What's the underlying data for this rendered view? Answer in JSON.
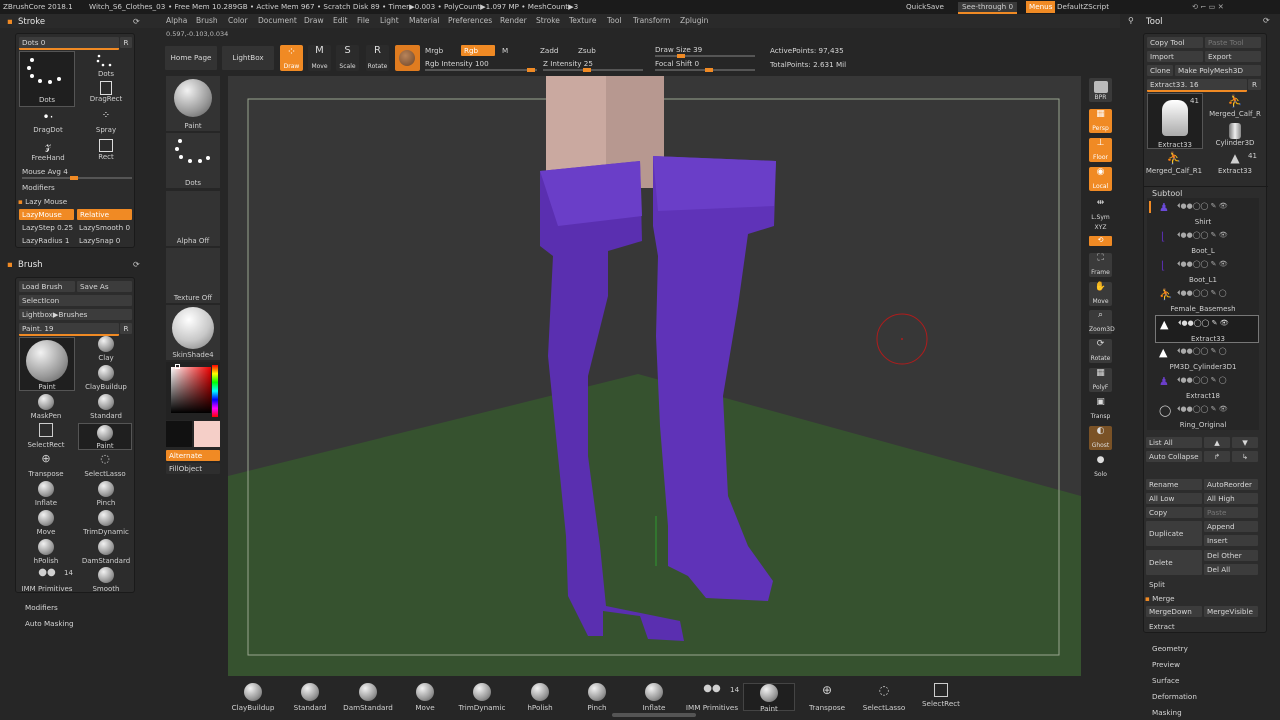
{
  "topbar": {
    "app": "ZBrushCore 2018.1",
    "file": "Witch_S6_Clothes_03",
    "free_mem": "• Free Mem 10.289GB • Active Mem 967 • Scratch Disk 89 • Timer▶0.003 • PolyCount▶1.097 MP • MeshCount▶3",
    "quicksave": "QuickSave",
    "see_through": "See-through  0",
    "menus": "Menus",
    "script": "DefaultZScript"
  },
  "menu": [
    "Alpha",
    "Brush",
    "Color",
    "Document",
    "Draw",
    "Edit",
    "File",
    "Light",
    "Material",
    "Preferences",
    "Render",
    "Stroke",
    "Texture",
    "Tool",
    "Transform",
    "Zplugin"
  ],
  "coords": "0.597,-0.103,0.034",
  "stroke": {
    "title": "Stroke",
    "dots_slider": "Dots  0",
    "r": "R",
    "dots": "Dots",
    "dots2": "Dots",
    "dragrect": "DragRect",
    "dragdot": "DragDot",
    "spray": "Spray",
    "freehand": "FreeHand",
    "rect": "Rect",
    "mouse_avg": "Mouse Avg 4",
    "modifiers": "Modifiers",
    "lazy_mouse": "Lazy Mouse",
    "lazymouse": "LazyMouse",
    "relative": "Relative",
    "lazystep": "LazyStep 0.25",
    "lazysmooth": "LazySmooth 0",
    "lazyradius": "LazyRadius 1",
    "lazysnap": "LazySnap 0"
  },
  "brush": {
    "title": "Brush",
    "load": "Load Brush",
    "save": "Save As",
    "selecticon": "SelectIcon",
    "lightbox": "Lightbox▶Brushes",
    "paint_slider": "Paint. 19",
    "r": "R",
    "items": [
      "Paint",
      "Clay",
      "ClayBuildup",
      "MaskPen",
      "Standard",
      "SelectRect",
      "Paint",
      "Transpose",
      "SelectLasso",
      "Inflate",
      "Pinch",
      "Move",
      "TrimDynamic",
      "hPolish",
      "DamStandard",
      "IMM Primitives",
      "Smooth"
    ],
    "imm_count": "14",
    "modifiers": "Modifiers",
    "auto_masking": "Auto Masking"
  },
  "toolbar": {
    "home": "Home Page",
    "lightbox": "LightBox",
    "draw": "Draw",
    "move": "Move",
    "scale": "Scale",
    "rotate": "Rotate",
    "mrgb": "Mrgb",
    "rgb": "Rgb",
    "m": "M",
    "rgb_intensity": "Rgb Intensity 100",
    "zadd": "Zadd",
    "zsub": "Zsub",
    "z_intensity": "Z Intensity 25",
    "draw_size": "Draw Size 39",
    "focal_shift": "Focal Shift 0",
    "active_points": "ActivePoints: 97,435",
    "total_points": "TotalPoints: 2.631 Mil"
  },
  "leftshelf": {
    "paint": "Paint",
    "dots": "Dots",
    "alpha": "Alpha Off",
    "texture": "Texture Off",
    "material": "SkinShade4",
    "alternate": "Alternate",
    "fillobject": "FillObject"
  },
  "rightshelf": [
    "BPR",
    "Persp",
    "Floor",
    "Local",
    "L.Sym",
    "Frame",
    "Move",
    "Zoom3D",
    "Rotate",
    "PolyF",
    "Transp",
    "Ghost",
    "Solo"
  ],
  "xyz": "XYZ",
  "tool": {
    "title": "Tool",
    "copy": "Copy Tool",
    "paste": "Paste Tool",
    "import": "Import",
    "export": "Export",
    "clone": "Clone",
    "make_polymesh": "Make PolyMesh3D",
    "extract_slider": "Extract33. 16",
    "r": "R",
    "thumbs": [
      "Extract33",
      "Merged_Calf_R",
      "Cylinder3D",
      "Merged_Calf_R1",
      "Extract33"
    ],
    "count1": "41",
    "count2": "41"
  },
  "subtool": {
    "title": "Subtool",
    "items": [
      "Shirt",
      "Boot_L",
      "Boot_L1",
      "Female_Basemesh",
      "Extract33",
      "PM3D_Cylinder3D1",
      "Extract18",
      "Ring_Original"
    ],
    "list_all": "List All",
    "auto_collapse": "Auto Collapse",
    "rename": "Rename",
    "autoreorder": "AutoReorder",
    "all_low": "All Low",
    "all_high": "All High",
    "copy": "Copy",
    "paste": "Paste",
    "duplicate": "Duplicate",
    "append": "Append",
    "insert": "Insert",
    "delete": "Delete",
    "del_other": "Del Other",
    "del_all": "Del All",
    "split": "Split",
    "merge": "Merge",
    "mergedown": "MergeDown",
    "mergevisible": "MergeVisible",
    "extract": "Extract"
  },
  "toolsections": [
    "Geometry",
    "Preview",
    "Surface",
    "Deformation",
    "Masking"
  ],
  "bottom": [
    "ClayBuildup",
    "Standard",
    "DamStandard",
    "Move",
    "TrimDynamic",
    "hPolish",
    "Pinch",
    "Inflate",
    "IMM Primitives",
    "Paint",
    "Transpose",
    "SelectLasso",
    "SelectRect"
  ],
  "bottom_imm_count": "14",
  "colors": {
    "accent": "#f08a24",
    "boot": "#5a2fb0",
    "floor": "#36522f",
    "canvas": "#373737"
  }
}
